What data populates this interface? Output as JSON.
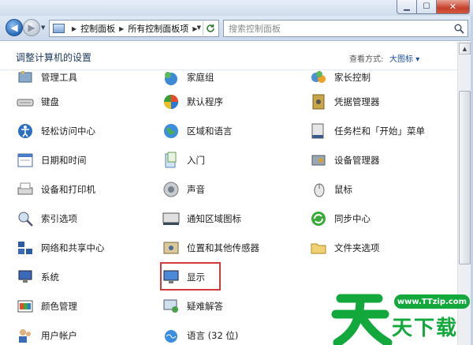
{
  "window": {
    "min_glyph": "▁",
    "max_glyph": "☐",
    "close_glyph": "✕"
  },
  "nav": {
    "back_glyph": "◀",
    "forward_glyph": "▶",
    "breadcrumb": [
      "控制面板",
      "所有控制面板项"
    ],
    "search_placeholder": "搜索控制面板"
  },
  "header": {
    "title": "调整计算机的设置",
    "view_by_label": "查看方式:",
    "view_by_value": "大图标"
  },
  "items": [
    {
      "label": "管理工具",
      "icon": "admin-tools-icon"
    },
    {
      "label": "家庭组",
      "icon": "homegroup-icon"
    },
    {
      "label": "家长控制",
      "icon": "parental-controls-icon"
    },
    {
      "label": "键盘",
      "icon": "keyboard-icon"
    },
    {
      "label": "默认程序",
      "icon": "default-programs-icon"
    },
    {
      "label": "凭据管理器",
      "icon": "credential-manager-icon"
    },
    {
      "label": "轻松访问中心",
      "icon": "ease-of-access-icon"
    },
    {
      "label": "区域和语言",
      "icon": "region-language-icon"
    },
    {
      "label": "任务栏和「开始」菜单",
      "icon": "taskbar-start-icon"
    },
    {
      "label": "日期和时间",
      "icon": "date-time-icon"
    },
    {
      "label": "入门",
      "icon": "getting-started-icon"
    },
    {
      "label": "设备管理器",
      "icon": "device-manager-icon"
    },
    {
      "label": "设备和打印机",
      "icon": "devices-printers-icon"
    },
    {
      "label": "声音",
      "icon": "sound-icon"
    },
    {
      "label": "鼠标",
      "icon": "mouse-icon"
    },
    {
      "label": "索引选项",
      "icon": "indexing-options-icon"
    },
    {
      "label": "通知区域图标",
      "icon": "notification-area-icon"
    },
    {
      "label": "同步中心",
      "icon": "sync-center-icon"
    },
    {
      "label": "网络和共享中心",
      "icon": "network-sharing-icon"
    },
    {
      "label": "位置和其他传感器",
      "icon": "location-sensors-icon"
    },
    {
      "label": "文件夹选项",
      "icon": "folder-options-icon"
    },
    {
      "label": "系统",
      "icon": "system-icon"
    },
    {
      "label": "显示",
      "icon": "display-icon"
    },
    {
      "label": "",
      "icon": ""
    },
    {
      "label": "颜色管理",
      "icon": "color-management-icon"
    },
    {
      "label": "疑难解答",
      "icon": "troubleshooting-icon"
    },
    {
      "label": "",
      "icon": ""
    },
    {
      "label": "用户帐户",
      "icon": "user-accounts-icon"
    },
    {
      "label": "语言 (32 位)",
      "icon": "language-icon"
    },
    {
      "label": "",
      "icon": ""
    }
  ],
  "watermark": {
    "url": "www.TTzip.com",
    "text": "天下载"
  },
  "colors": {
    "highlight": "#d33a3a",
    "watermark_green": "#12a83c"
  }
}
